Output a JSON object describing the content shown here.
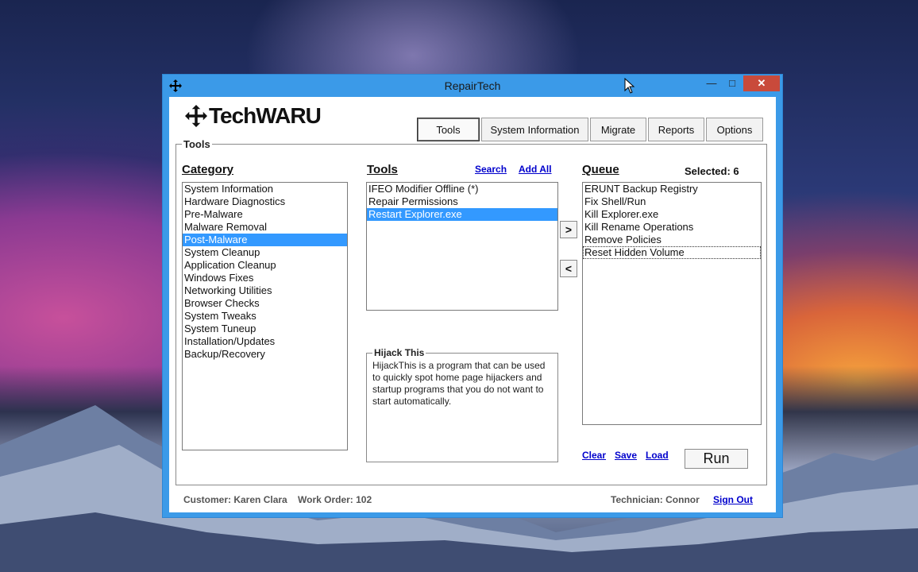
{
  "window": {
    "title": "RepairTech",
    "controls": {
      "minimize": "—",
      "maximize": "□",
      "close": "✕"
    }
  },
  "logo": {
    "text": "TechWARU"
  },
  "nav": {
    "tabs": [
      {
        "label": "Tools",
        "active": true
      },
      {
        "label": "System Information",
        "active": false
      },
      {
        "label": "Migrate",
        "active": false
      },
      {
        "label": "Reports",
        "active": false
      },
      {
        "label": "Options",
        "active": false
      }
    ]
  },
  "tools_panel": {
    "legend": "Tools",
    "category": {
      "header": "Category",
      "items": [
        "System Information",
        "Hardware Diagnostics",
        "Pre-Malware",
        "Malware Removal",
        "Post-Malware",
        "System Cleanup",
        "Application Cleanup",
        "Windows Fixes",
        "Networking Utilities",
        "Browser Checks",
        "System Tweaks",
        "System Tuneup",
        "Installation/Updates",
        "Backup/Recovery"
      ],
      "selected_index": 4
    },
    "tools": {
      "header": "Tools",
      "search_link": "Search",
      "add_all_link": "Add All",
      "items": [
        "IFEO Modifier Offline (*)",
        "Repair Permissions",
        "Restart Explorer.exe"
      ],
      "selected_index": 2
    },
    "move_buttons": {
      "add": ">",
      "remove": "<"
    },
    "description": {
      "legend": "Hijack This",
      "text": "HijackThis is a program that can be used to quickly spot home page hijackers and startup programs that you do not want to start automatically."
    },
    "queue": {
      "header": "Queue",
      "selected_label": "Selected: 6",
      "items": [
        "ERUNT Backup Registry",
        "Fix Shell/Run",
        "Kill Explorer.exe",
        "Kill Rename Operations",
        "Remove Policies",
        "Reset Hidden Volume"
      ],
      "focused_index": 5
    },
    "queue_actions": {
      "clear": "Clear",
      "save": "Save",
      "load": "Load",
      "run": "Run"
    }
  },
  "status_bar": {
    "customer": "Customer: Karen Clara",
    "work_order": "Work Order: 102",
    "technician": "Technician: Connor",
    "sign_out": "Sign Out"
  },
  "colors": {
    "titlebar": "#3b9ae8",
    "selection": "#3399ff",
    "link": "#0000cc",
    "close_button": "#c94a3b"
  }
}
